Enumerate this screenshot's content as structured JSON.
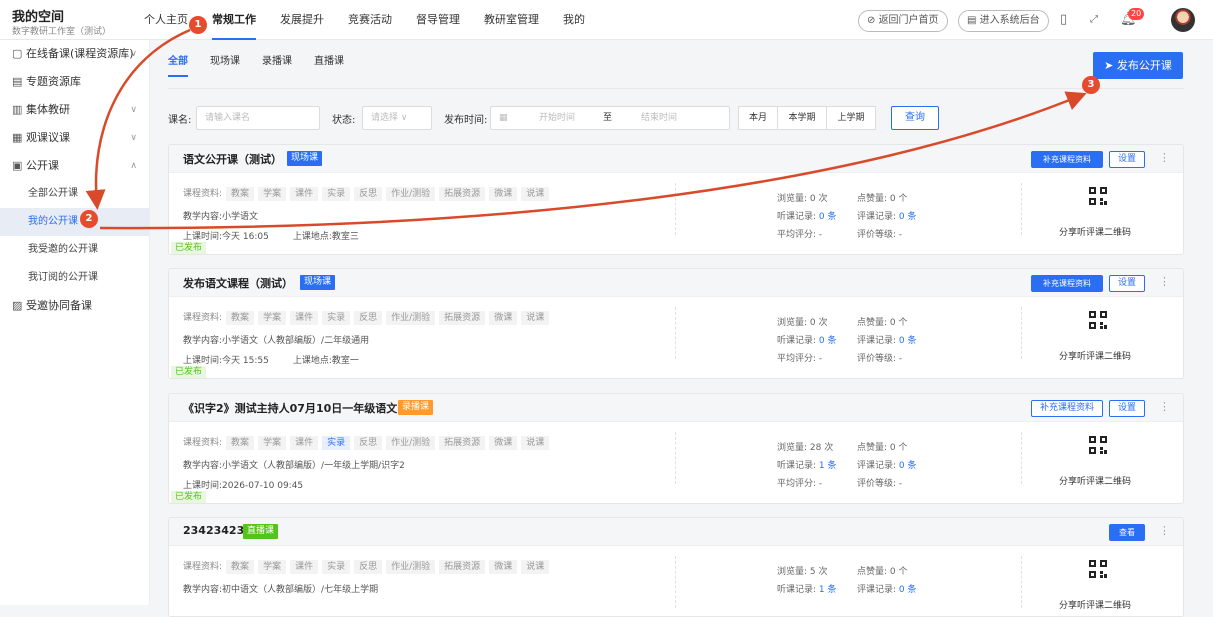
{
  "brand": {
    "title": "我的空间",
    "subtitle": "数字教研工作室（测试）"
  },
  "nav": [
    "个人主页",
    "常规工作",
    "发展提升",
    "竞赛活动",
    "督导管理",
    "教研室管理",
    "我的"
  ],
  "header": {
    "portal": "返回门户首页",
    "backend": "进入系统后台",
    "notif_count": "20"
  },
  "sidebar": {
    "items": [
      "在线备课(课程资源库)",
      "专题资源库",
      "集体教研",
      "观课议课",
      "公开课",
      "受邀协同备课"
    ],
    "sub": [
      "全部公开课",
      "我的公开课",
      "我受邀的公开课",
      "我订阅的公开课"
    ]
  },
  "tabs": [
    "全部",
    "现场课",
    "录播课",
    "直播课"
  ],
  "publish": "发布公开课",
  "filters": {
    "course_label": "课名:",
    "course_ph": "请输入课名",
    "status_label": "状态:",
    "status_ph": "请选择",
    "time_label": "发布时间:",
    "start_ph": "开始时间",
    "to": "至",
    "end_ph": "结束时间",
    "month": "本月",
    "term": "本学期",
    "last_term": "上学期",
    "query": "查询"
  },
  "labels": {
    "resources": "课程资料:",
    "content": "教学内容:",
    "time": "上课时间:",
    "place": "上课地点:",
    "views": "浏览量:",
    "likes": "点赞量:",
    "records": "听课记录:",
    "comments": "评课记录:",
    "avg": "平均评分:",
    "grade": "评价等级:",
    "qr": "分享听评课二维码",
    "published": "已发布",
    "supplement": "补充课程资料",
    "settings": "设置",
    "view": "查看"
  },
  "resource_tags": [
    "教案",
    "学案",
    "课件",
    "实录",
    "反思",
    "作业/测验",
    "拓展资源",
    "微课",
    "说课"
  ],
  "courses": [
    {
      "title": "语文公开课（测试）",
      "tag": "现场课",
      "content": "小学语文",
      "time": "今天 16:05",
      "place": "教室三",
      "views": "0 次",
      "likes": "0 个",
      "records": "0 条",
      "comments": "0 条",
      "avg": "-",
      "grade": "-"
    },
    {
      "title": "发布语文课程（测试）",
      "tag": "现场课",
      "content": "小学语文（人教部编版）/二年级通用",
      "time": "今天 15:55",
      "place": "教室一",
      "views": "0 次",
      "likes": "0 个",
      "records": "0 条",
      "comments": "0 条",
      "avg": "-",
      "grade": "-"
    },
    {
      "title": "《识字2》测试主持人07月10日一年级语文",
      "tag": "录播课",
      "content": "小学语文（人教部编版）/一年级上学期/识字2",
      "time": "2026-07-10 09:45",
      "place": "",
      "views": "28 次",
      "likes": "0 个",
      "records": "1 条",
      "comments": "0 条",
      "avg": "-",
      "grade": "-"
    },
    {
      "title": "234234234",
      "tag": "直播课",
      "content": "初中语文（人教部编版）/七年级上学期",
      "time": "",
      "place": "",
      "views": "5 次",
      "likes": "0 个",
      "records": "1 条",
      "comments": "0 条",
      "avg": "",
      "grade": ""
    }
  ],
  "markers": [
    "1",
    "2",
    "3"
  ]
}
